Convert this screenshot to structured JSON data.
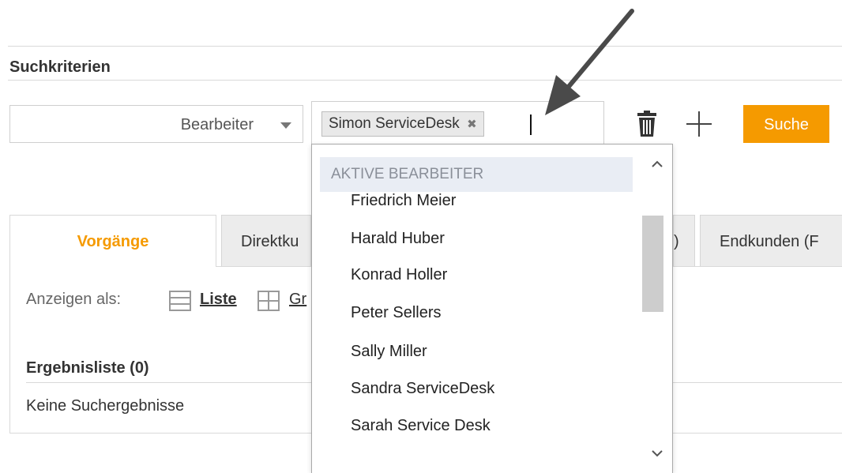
{
  "section": {
    "title": "Suchkriterien"
  },
  "criteria": {
    "field_label": "Bearbeiter",
    "selected_value": "Simon ServiceDesk",
    "chip_remove": "✖",
    "search_label": "Suche"
  },
  "icons": {
    "caret": "chevron-down-icon",
    "trash": "trash-icon",
    "plus": "plus-icon",
    "remove": "close-icon",
    "list": "list-icon",
    "grid": "grid-icon",
    "scroll_up": "chevron-up-icon",
    "scroll_down": "chevron-down-icon",
    "annotation": "arrow-icon"
  },
  "tabs": [
    {
      "label": "Vorgänge",
      "active": true
    },
    {
      "label": "Direktku"
    },
    {
      "label": ")"
    },
    {
      "label": "Endkunden (F"
    }
  ],
  "view": {
    "show_as": "Anzeigen als:",
    "list": "Liste",
    "grid": "Gr"
  },
  "results": {
    "title": "Ergebnisliste (0)",
    "empty": "Keine Suchergebnisse"
  },
  "dropdown": {
    "group": "AKTIVE BEARBEITER",
    "items": [
      "Friedrich Meier",
      "Harald Huber",
      "Konrad Holler",
      "Peter Sellers",
      "Sally Miller",
      "Sandra ServiceDesk",
      "Sarah Service Desk"
    ]
  },
  "colors": {
    "accent": "#f59a00",
    "group_bg": "#e9edf4",
    "tab_inactive_bg": "#ececec",
    "border": "#d9d9d9"
  }
}
